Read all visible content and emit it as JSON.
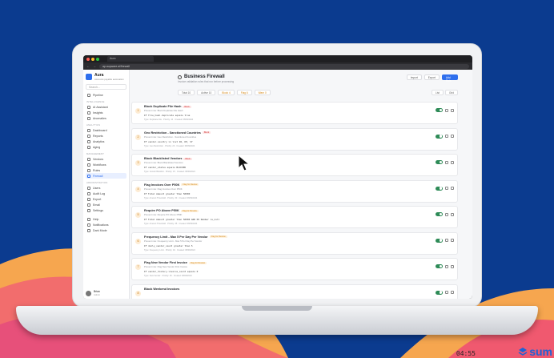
{
  "browser": {
    "tab_title": "Aura",
    "url": "ap.aupware.ai/firewall"
  },
  "sidebar": {
    "brand_name": "Aura",
    "brand_sub": "Accounts payable automation",
    "search_placeholder": "Search...",
    "top_items": [
      {
        "label": "Pipeline"
      }
    ],
    "sections": [
      {
        "title": "INTELLIGENCE",
        "items": [
          {
            "label": "AI Assistant"
          },
          {
            "label": "Insights"
          },
          {
            "label": "Anomalies"
          }
        ]
      },
      {
        "title": "ANALYTICS",
        "items": [
          {
            "label": "Dashboard"
          },
          {
            "label": "Reports"
          },
          {
            "label": "Analytics"
          },
          {
            "label": "Aging"
          }
        ]
      },
      {
        "title": "MANAGEMENT",
        "items": [
          {
            "label": "Vendors"
          },
          {
            "label": "Workflows"
          },
          {
            "label": "Rules"
          },
          {
            "label": "Firewall"
          }
        ]
      },
      {
        "title": "ADMINISTRATION",
        "items": [
          {
            "label": "Users"
          },
          {
            "label": "Audit Log"
          },
          {
            "label": "Export"
          },
          {
            "label": "Email"
          },
          {
            "label": "Settings"
          }
        ]
      }
    ],
    "bottom_items": [
      {
        "label": "Help"
      },
      {
        "label": "Notifications"
      },
      {
        "label": "Dark Mode"
      }
    ],
    "user": {
      "name": "Brian",
      "role": "Admin"
    }
  },
  "page": {
    "title": "Business Firewall",
    "subtitle": "Invoice validation rules that run before processing",
    "actions": {
      "import": "Import",
      "export": "Export",
      "add": "Add Rule"
    }
  },
  "filters": [
    "Total 10",
    "Active 10",
    "Block 4",
    "Flag 6",
    "Warn 0"
  ],
  "view_modes": [
    "List",
    "Grid"
  ],
  "rules": [
    {
      "num": "1",
      "title": "Block Duplicate File Hash",
      "badge": "Block",
      "badge_type": "block",
      "desc": "Prevent rule: Block Duplicate File Hash",
      "cond": "IF file_hash.duplicate equals true",
      "meta": "Type: Duplicate File  ·  Priority: 10  ·  Created: 08/09/2024"
    },
    {
      "num": "2",
      "title": "Geo Restriction - Sanctioned Countries",
      "badge": "Block",
      "badge_type": "block",
      "desc": "Prevent rule: Geo Restriction - Sanctioned Countries",
      "cond": "IF vendor.country in list IR, KP, SY",
      "meta": "Type: Geo Restriction  ·  Priority: 20  ·  Created: 08/09/2024"
    },
    {
      "num": "3",
      "title": "Block Blacklisted Vendors",
      "badge": "Block",
      "badge_type": "block",
      "desc": "Prevent rule: Block Blacklisted Vendors",
      "cond": "IF vendor_status equals BLOCKED",
      "meta": "Type: Vendor Blocklist  ·  Priority: 15  ·  Created: 08/09/2024"
    },
    {
      "num": "4",
      "title": "Flag Invoices Over P50K",
      "badge": "Flag for Review",
      "badge_type": "flag",
      "desc": "Prevent rule: Flag Invoices Over P50K",
      "cond": "IF Total Amount greater than 50000",
      "meta": "Type: Amount Threshold  ·  Priority: 30  ·  Created: 08/09/2024"
    },
    {
      "num": "5",
      "title": "Require PO Above P50K",
      "badge": "Flag for Review",
      "badge_type": "flag",
      "desc": "Prevent rule: Require PO Above P50K",
      "cond": "IF Total Amount greater than 50000 AND PO Number is_null",
      "meta": "Type: Amount Threshold  ·  Priority: 35  ·  Created: 08/09/2024"
    },
    {
      "num": "6",
      "title": "Frequency Limit - Max 5 Per Day Per Vendor",
      "badge": "Flag for Review",
      "badge_type": "flag",
      "desc": "Prevent rule: Frequency Limit - Max 5 Per Day Per Vendor",
      "cond": "IF daily_vendor_count greater than 5",
      "meta": "Type: Frequency Limit  ·  Priority: 40  ·  Created: 08/09/2024"
    },
    {
      "num": "7",
      "title": "Flag New Vendor First Invoice",
      "badge": "Flag for Review",
      "badge_type": "flag",
      "desc": "Prevent rule: Flag New Vendor First Invoice",
      "cond": "IF vendor_history.invoice_count equals 0",
      "meta": "Type: New Vendor  ·  Priority: 45  ·  Created: 08/09/2024"
    },
    {
      "num": "8",
      "title": "Block Weekend Invoices",
      "badge": "",
      "badge_type": "flag",
      "desc": "",
      "cond": "",
      "meta": ""
    }
  ],
  "overlay": {
    "clock": "04:55",
    "logo_text": "sum"
  },
  "colors": {
    "background": "#0b3b8f",
    "accent": "#2f6fed",
    "toggle_on": "#2e8b57",
    "block": "#d23b3b",
    "flag": "#d58a1c",
    "logo": "#1e63d6"
  }
}
